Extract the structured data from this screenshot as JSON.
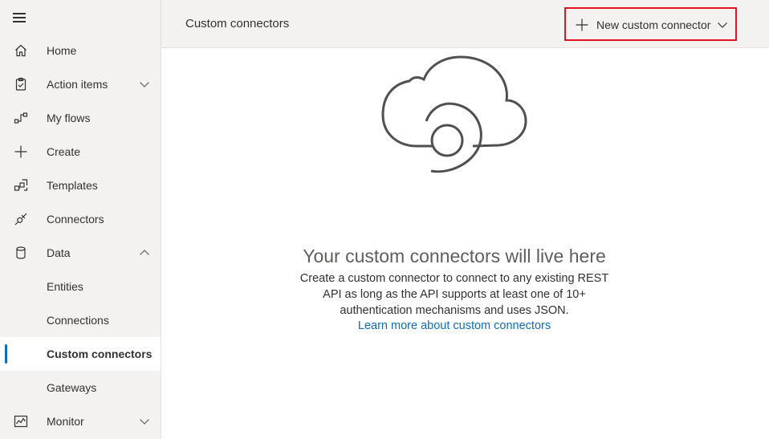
{
  "header": {
    "title": "Custom connectors",
    "new_button_label": "New custom connector"
  },
  "sidebar": {
    "items": [
      {
        "label": "Home",
        "icon": "home-icon"
      },
      {
        "label": "Action items",
        "icon": "clipboard-icon",
        "chevron": "down"
      },
      {
        "label": "My flows",
        "icon": "flow-icon"
      },
      {
        "label": "Create",
        "icon": "plus-icon"
      },
      {
        "label": "Templates",
        "icon": "templates-icon"
      },
      {
        "label": "Connectors",
        "icon": "connector-plug-icon"
      },
      {
        "label": "Data",
        "icon": "database-icon",
        "chevron": "up"
      },
      {
        "label": "Entities"
      },
      {
        "label": "Connections"
      },
      {
        "label": "Custom connectors",
        "active": true
      },
      {
        "label": "Gateways"
      },
      {
        "label": "Monitor",
        "icon": "monitor-chart-icon",
        "chevron": "down"
      }
    ]
  },
  "empty_state": {
    "icon": "cloud-connector-icon",
    "title": "Your custom connectors will live here",
    "description": "Create a custom connector to connect to any existing REST API as long as the API supports at least one of 10+ authentication mechanisms and uses JSON.",
    "link": "Learn more about custom connectors"
  },
  "colors": {
    "accent": "#0f6cbd",
    "highlight_border": "#e81123",
    "sidebar_bg": "#f3f2f1"
  }
}
